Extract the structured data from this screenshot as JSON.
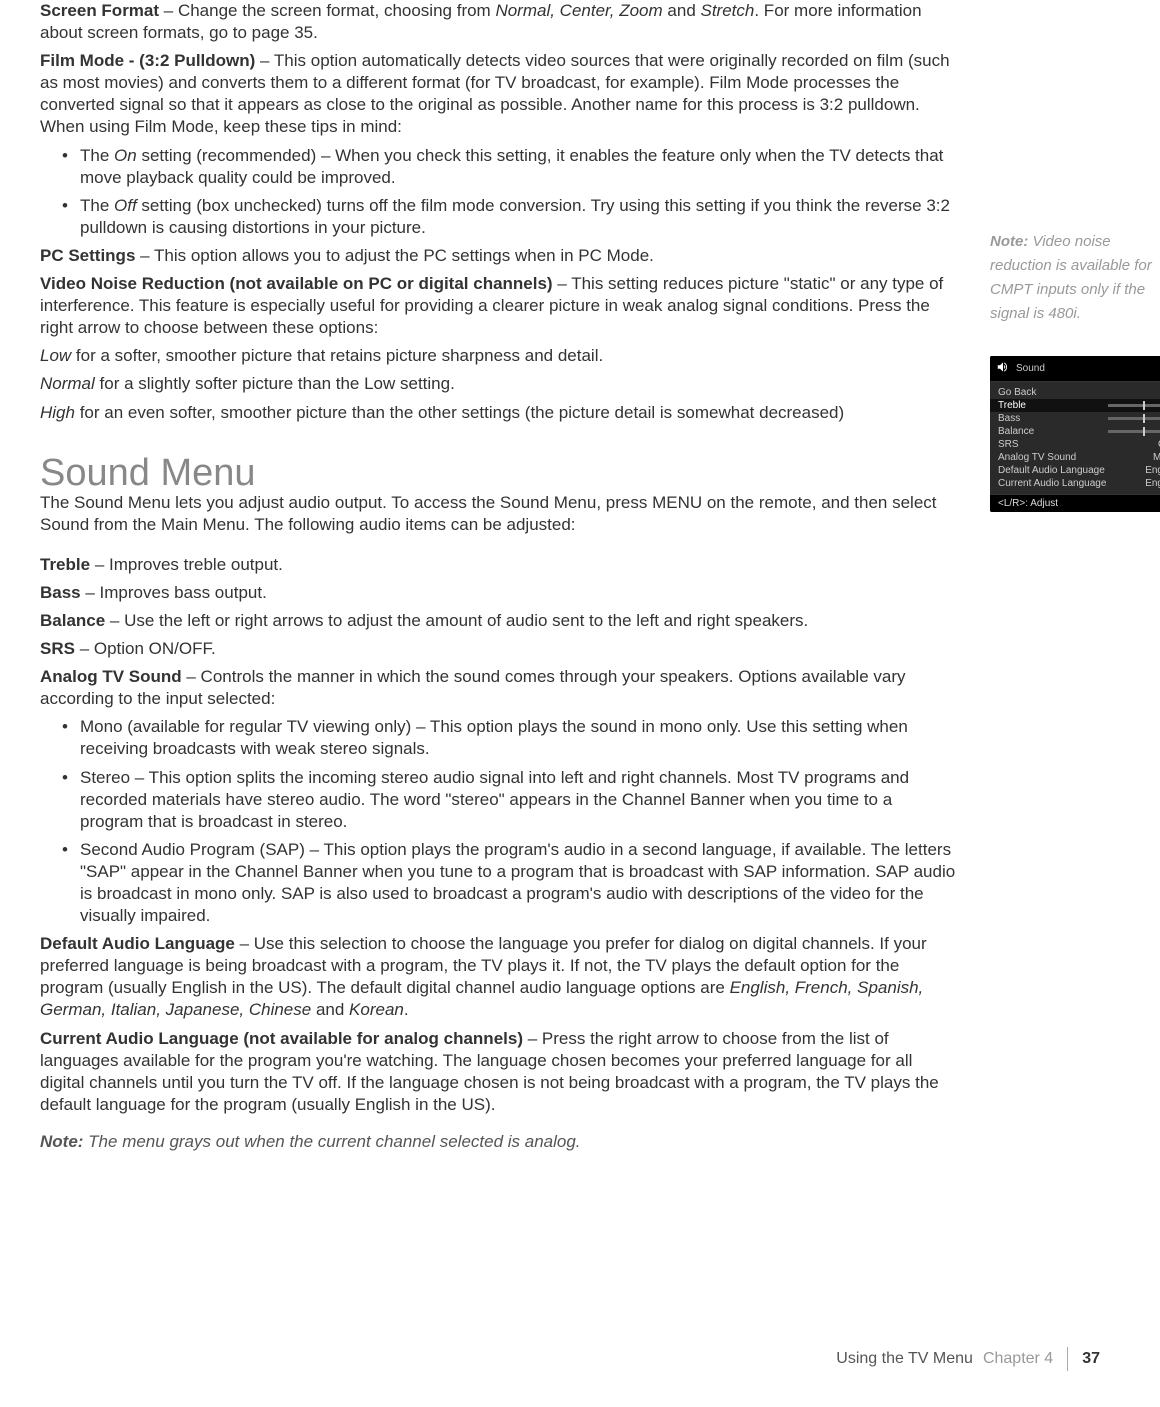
{
  "sections": {
    "screen_format": {
      "term": "Screen Format",
      "text1": " – Change the screen format, choosing from ",
      "ital1": "Normal, Center, Zoom",
      "text2": " and ",
      "ital2": "Stretch",
      "text3": ".  For more information about screen formats, go to page 35."
    },
    "film_mode": {
      "term": "Film Mode -  (3:2 Pulldown)",
      "text": " – This option automatically detects video sources that were originally recorded on film (such as most movies) and converts them to a different format (for TV broadcast, for example).  Film Mode processes the converted signal so that it appears as close to the original as possible.  Another name for this process is 3:2 pulldown.  When using Film Mode, keep these tips in mind:",
      "bullets": [
        {
          "pre": "The ",
          "ital": "On",
          "post": " setting (recommended) – When you check this setting, it enables the feature only when the TV detects that move playback quality could be improved."
        },
        {
          "pre": "The ",
          "ital": "Off",
          "post": " setting (box unchecked) turns off the film mode conversion.  Try using this setting if you think the reverse 3:2 pulldown is causing distortions in your picture."
        }
      ]
    },
    "pc_settings": {
      "term": "PC Settings",
      "text": " – This option allows you to adjust the PC settings when in PC Mode."
    },
    "vnr": {
      "term": "Video Noise Reduction (not available on PC or digital channels)",
      "text": " – This setting reduces picture \"static\" or any type of interference. This feature is especially useful for providing a clearer picture in weak analog signal conditions. Press the right arrow to choose between these options:"
    },
    "low": {
      "ital": "Low",
      "text": " for a softer, smoother picture that retains picture sharpness and detail."
    },
    "normal": {
      "ital": "Normal",
      "text": " for a slightly softer picture than the Low setting."
    },
    "high": {
      "ital": "High",
      "text": " for an even softer, smoother picture than the other settings (the picture detail is somewhat decreased)"
    }
  },
  "sound": {
    "heading": "Sound Menu",
    "intro": "The Sound Menu lets you adjust audio output. To access the Sound Menu, press MENU on the remote, and then select Sound from the Main Menu. The following audio items can be adjusted:",
    "treble": {
      "term": "Treble",
      "text": " – Improves treble output."
    },
    "bass": {
      "term": "Bass",
      "text": " – Improves bass output."
    },
    "balance": {
      "term": "Balance",
      "text": " – Use the left or right arrows to adjust the amount of audio sent to the left and right speakers."
    },
    "srs": {
      "term": "SRS",
      "text": " – Option ON/OFF."
    },
    "analog": {
      "term": "Analog TV Sound",
      "text": " – Controls the manner in which the sound comes through your speakers.  Options available vary according to the input selected:",
      "bullets": [
        "Mono (available for regular TV viewing only) – This option plays the sound in mono only.  Use this setting when receiving broadcasts with weak stereo signals.",
        "Stereo – This option splits the incoming stereo audio signal into left and right channels.  Most TV programs and recorded materials have stereo audio.  The word \"stereo\" appears in the Channel Banner when you time to a program that is broadcast in stereo.",
        "Second Audio Program (SAP) – This option plays the program's audio in a second language, if available.  The letters \"SAP\" appear in the Channel Banner when you tune to a program that is broadcast with SAP information.  SAP audio is broadcast in mono only.  SAP is also used to broadcast a program's audio with descriptions of the video for the visually impaired."
      ]
    },
    "default_lang": {
      "term": "Default Audio Language",
      "text1": " – Use this selection to choose the language you prefer for dialog on digital channels.  If your preferred language is being broadcast with a program, the TV plays it.  If not, the TV plays the default option for the program (usually English in the US).  The default digital channel audio language options are ",
      "ital": "English, French, Spanish, German, Italian, Japanese, Chinese",
      "text2": " and ",
      "ital2": "Korean",
      "text3": "."
    },
    "current_lang": {
      "term": "Current Audio Language (not available for analog channels)",
      "text": " – Press the right arrow to choose from the list of languages available for the program you're watching.  The language chosen becomes your preferred language for all digital channels until you turn the TV off.  If the language chosen is not being broadcast with a program, the TV plays the default language for the program (usually English in the US)."
    },
    "note": {
      "label": "Note:",
      "text": " The menu grays out when the current channel selected is analog."
    }
  },
  "side_note": {
    "label": "Note:",
    "text": " Video noise reduction is available for CMPT inputs only if the signal is 480i."
  },
  "osd": {
    "title": "Sound",
    "rows": [
      {
        "label": "Go Back",
        "value": ""
      },
      {
        "label": "Treble",
        "value": "slider",
        "tick": 50,
        "selected": true
      },
      {
        "label": "Bass",
        "value": "slider",
        "tick": 50
      },
      {
        "label": "Balance",
        "value": "slider",
        "tick": 50
      },
      {
        "label": "SRS",
        "value": "OFF"
      },
      {
        "label": "Analog TV Sound",
        "value": "Mono"
      },
      {
        "label": "Default Audio Language",
        "value": "English"
      },
      {
        "label": "Current Audio Language",
        "value": "English"
      }
    ],
    "footer": "<L/R>: Adjust"
  },
  "footer": {
    "section": "Using the TV Menu",
    "chapter": "Chapter 4",
    "page": "37"
  }
}
